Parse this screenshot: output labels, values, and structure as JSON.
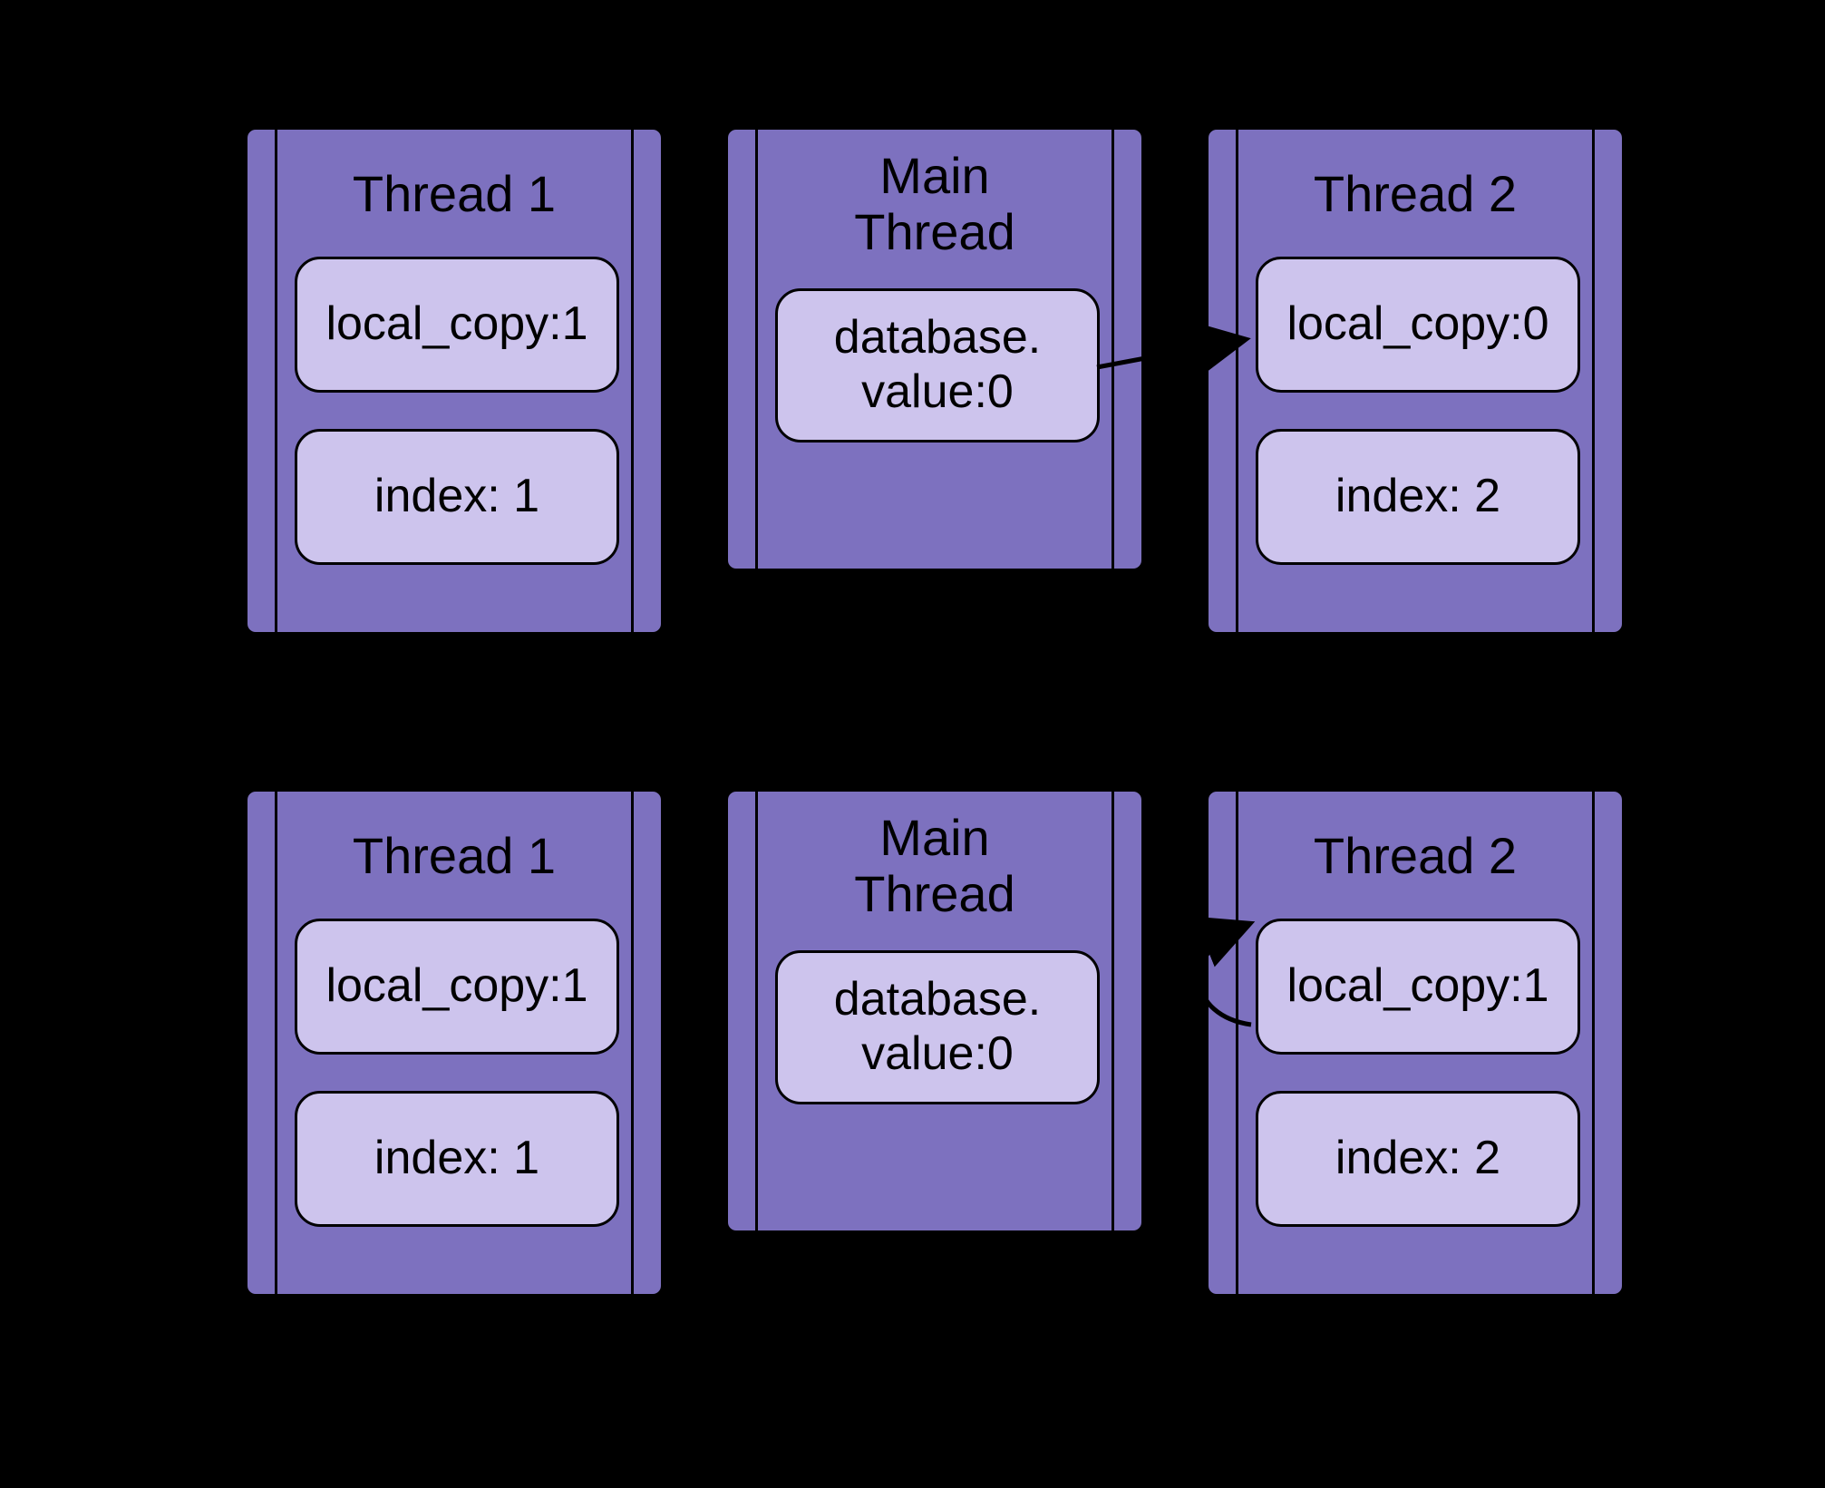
{
  "rows": [
    {
      "thread1": {
        "title": "Thread 1",
        "local_copy": "local_copy:1",
        "index": "index: 1"
      },
      "main": {
        "title": "Main\nThread",
        "db": "database.\nvalue:0"
      },
      "thread2": {
        "title": "Thread 2",
        "local_copy": "local_copy:0",
        "index": "index: 2"
      }
    },
    {
      "thread1": {
        "title": "Thread 1",
        "local_copy": "local_copy:1",
        "index": "index: 1"
      },
      "main": {
        "title": "Main\nThread",
        "db": "database.\nvalue:0"
      },
      "thread2": {
        "title": "Thread 2",
        "local_copy": "local_copy:1",
        "index": "index: 2"
      }
    }
  ]
}
